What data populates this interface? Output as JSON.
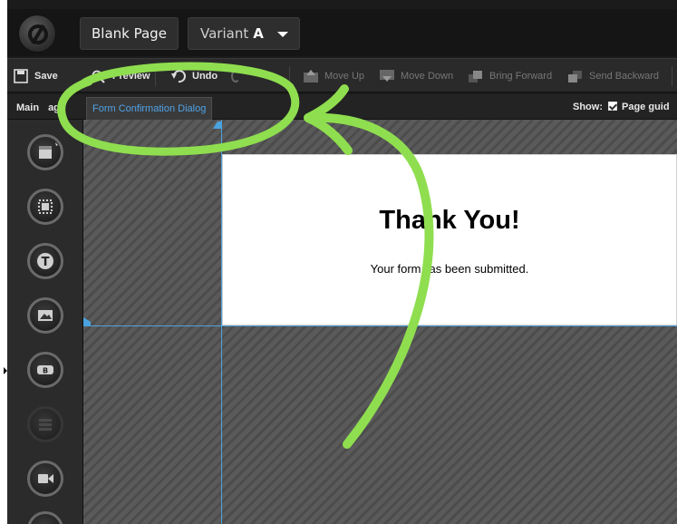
{
  "topbar": {
    "page_name": "Blank Page",
    "variant_prefix": "Variant",
    "variant_letter": "A"
  },
  "toolbar": {
    "save": "Save",
    "preview": "Preview",
    "undo": "Undo",
    "move_up": "Move Up",
    "move_down": "Move Down",
    "bring_forward": "Bring Forward",
    "send_backward": "Send Backward"
  },
  "tabs": {
    "main_left": "Main",
    "main_right": "age",
    "active": "Form Confirmation Dialog"
  },
  "show": {
    "label": "Show:",
    "option": "Page guid",
    "checked": true
  },
  "palette": [
    {
      "icon": "box-tool-icon",
      "enabled": true
    },
    {
      "icon": "section-tool-icon",
      "enabled": true
    },
    {
      "icon": "text-tool-icon",
      "enabled": true
    },
    {
      "icon": "image-tool-icon",
      "enabled": true
    },
    {
      "icon": "button-tool-icon",
      "enabled": true
    },
    {
      "icon": "form-tool-icon",
      "enabled": false
    },
    {
      "icon": "video-tool-icon",
      "enabled": true
    }
  ],
  "dialog": {
    "title_left": "Tha",
    "title_right": "nk You!",
    "message_left": "Your form",
    "message_right": "as been submitted."
  },
  "colors": {
    "accent": "#4fa3e8",
    "guide": "#4aa3df",
    "annotation": "#8fde4f"
  }
}
